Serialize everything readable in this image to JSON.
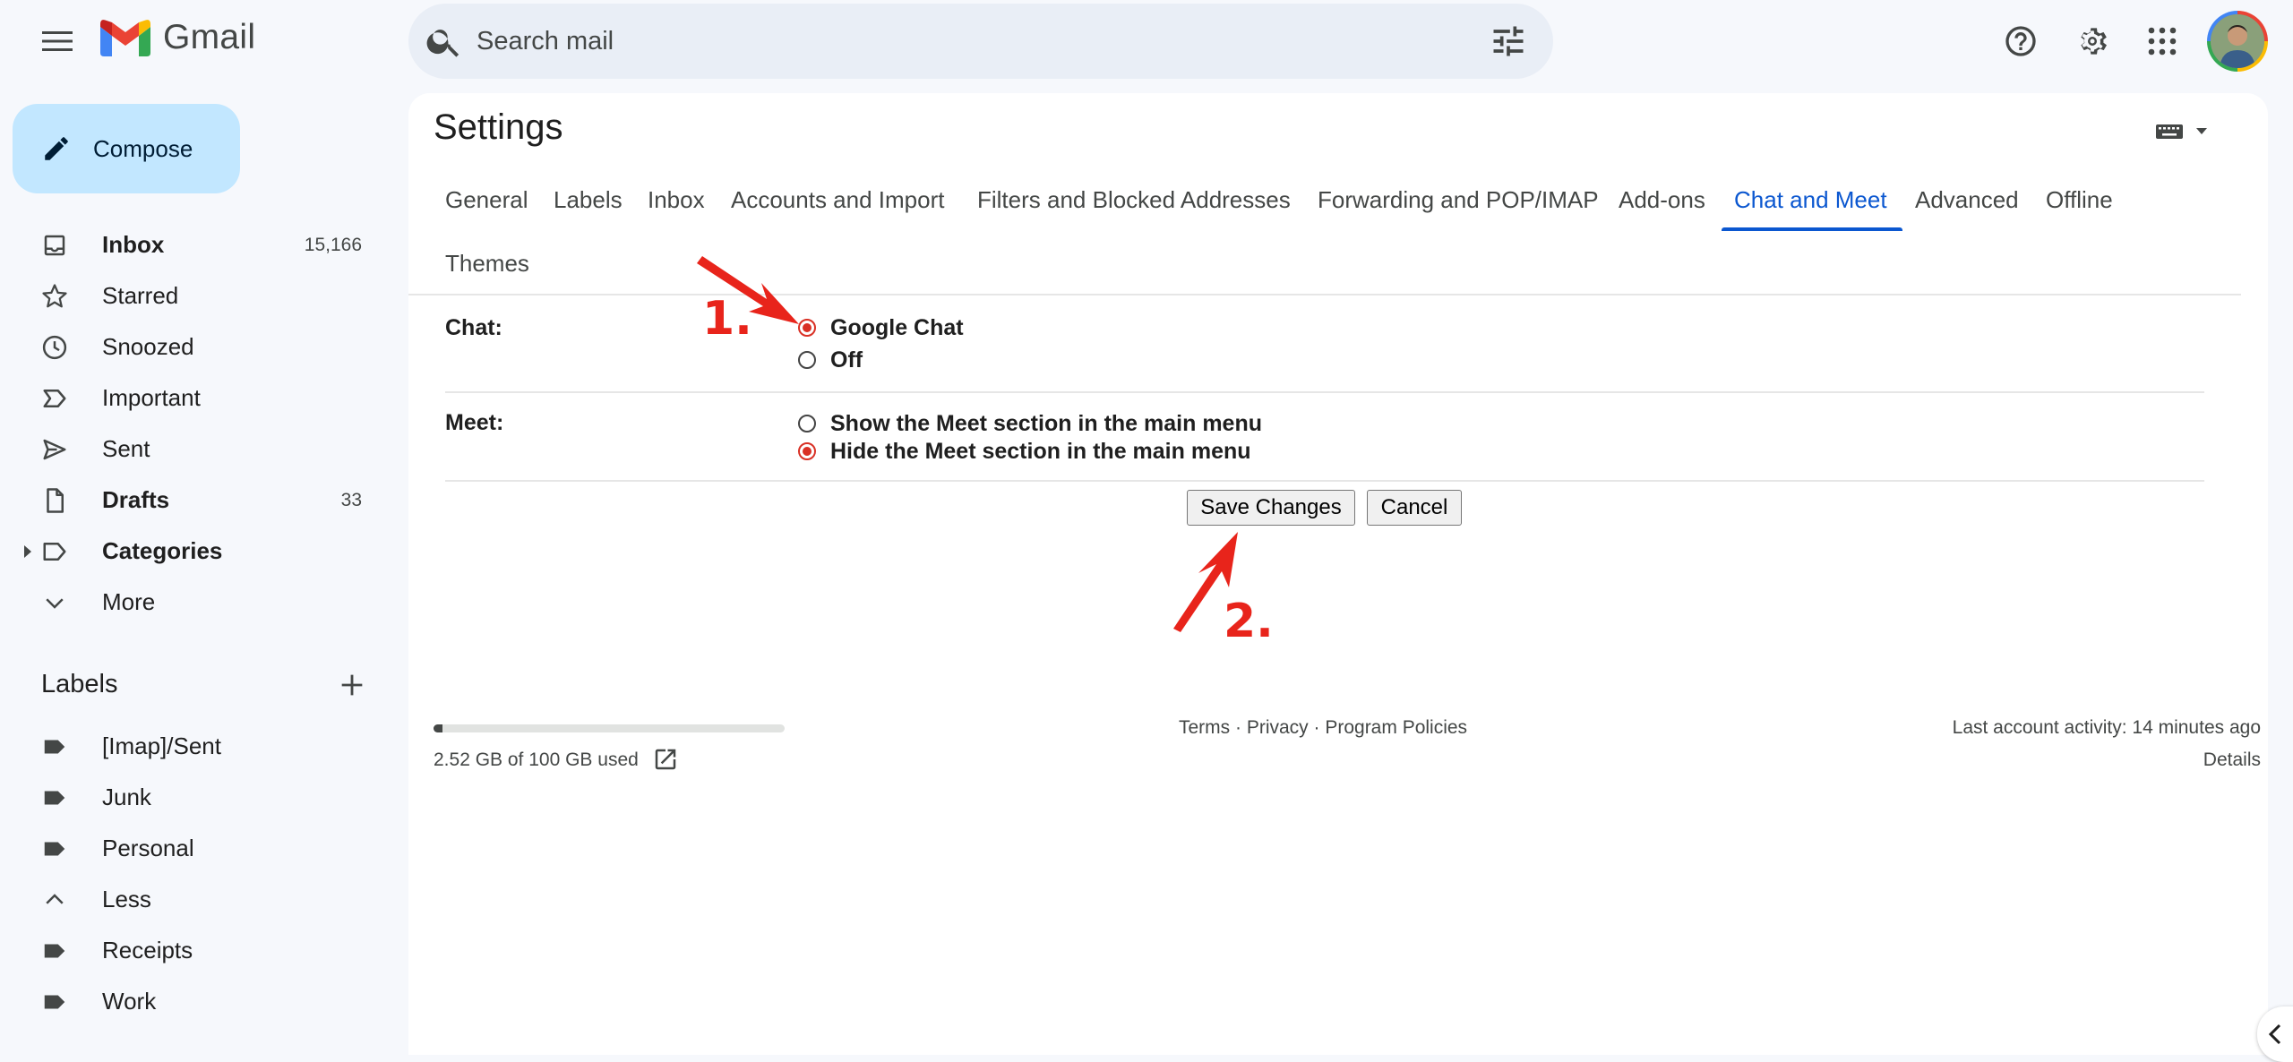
{
  "app": {
    "name": "Gmail",
    "search_placeholder": "Search mail"
  },
  "sidebar": {
    "compose_label": "Compose",
    "items": [
      {
        "label": "Inbox",
        "count": "15,166",
        "icon": "inbox-icon"
      },
      {
        "label": "Starred",
        "count": "",
        "icon": "star-icon"
      },
      {
        "label": "Snoozed",
        "count": "",
        "icon": "clock-icon"
      },
      {
        "label": "Important",
        "count": "",
        "icon": "important-icon"
      },
      {
        "label": "Sent",
        "count": "",
        "icon": "send-icon"
      },
      {
        "label": "Drafts",
        "count": "33",
        "icon": "draft-icon"
      },
      {
        "label": "Categories",
        "count": "",
        "icon": "label-outline-icon"
      },
      {
        "label": "More",
        "count": "",
        "icon": "chevron-down-icon"
      }
    ],
    "labels_heading": "Labels",
    "labels": [
      {
        "label": "[Imap]/Sent",
        "icon": "label-icon"
      },
      {
        "label": "Junk",
        "icon": "label-icon"
      },
      {
        "label": "Personal",
        "icon": "label-icon"
      },
      {
        "label": "Less",
        "icon": "chevron-up-icon"
      },
      {
        "label": "Receipts",
        "icon": "label-icon"
      },
      {
        "label": "Work",
        "icon": "label-icon"
      }
    ]
  },
  "settings": {
    "title": "Settings",
    "tabs": [
      "General",
      "Labels",
      "Inbox",
      "Accounts and Import",
      "Filters and Blocked Addresses",
      "Forwarding and POP/IMAP",
      "Add-ons",
      "Chat and Meet",
      "Advanced",
      "Offline",
      "Themes"
    ],
    "active_tab": "Chat and Meet",
    "chat": {
      "label": "Chat:",
      "options": [
        "Google Chat",
        "Off"
      ],
      "selected": "Google Chat"
    },
    "meet": {
      "label": "Meet:",
      "options": [
        "Show the Meet section in the main menu",
        "Hide the Meet section in the main menu"
      ],
      "selected": "Hide the Meet section in the main menu"
    },
    "save_label": "Save Changes",
    "cancel_label": "Cancel"
  },
  "footer": {
    "storage_text": "2.52 GB of 100 GB used",
    "storage_fraction": 0.0252,
    "links": "Terms · Privacy · Program Policies",
    "activity": "Last account activity: 14 minutes ago",
    "details": "Details"
  },
  "annotations": {
    "step1": "1.",
    "step2": "2.",
    "arrow_color": "#e8241b"
  },
  "colors": {
    "accent": "#0b57d0",
    "compose_bg": "#c2e7ff",
    "radio_selected": "#d93025"
  }
}
